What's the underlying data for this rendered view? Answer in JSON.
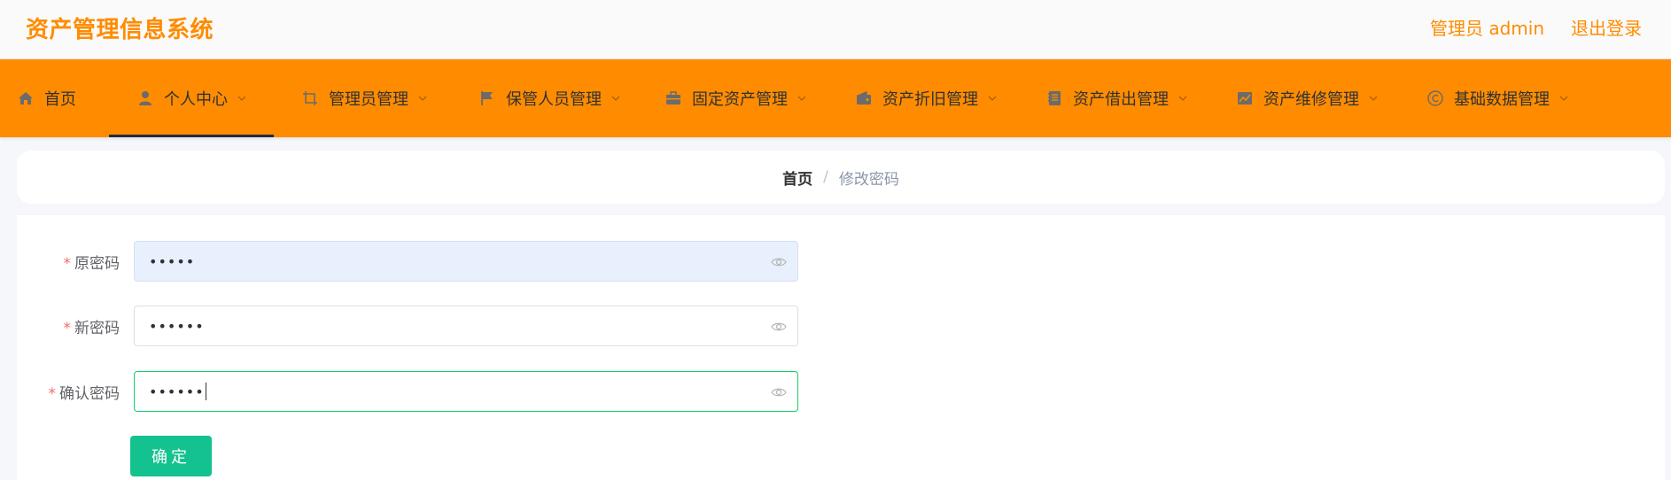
{
  "header": {
    "app_title": "资产管理信息系统",
    "user_label": "管理员 admin",
    "logout_label": "退出登录"
  },
  "nav": {
    "items": [
      {
        "label": "首页",
        "icon": "home-icon"
      },
      {
        "label": "个人中心",
        "icon": "user-icon"
      },
      {
        "label": "管理员管理",
        "icon": "crop-icon"
      },
      {
        "label": "保管人员管理",
        "icon": "flag-icon"
      },
      {
        "label": "固定资产管理",
        "icon": "briefcase-icon"
      },
      {
        "label": "资产折旧管理",
        "icon": "wallet-icon"
      },
      {
        "label": "资产借出管理",
        "icon": "notebook-icon"
      },
      {
        "label": "资产维修管理",
        "icon": "chart-icon"
      },
      {
        "label": "基础数据管理",
        "icon": "copyright-icon"
      }
    ],
    "active_index": 1
  },
  "breadcrumb": {
    "home": "首页",
    "separator": "/",
    "current": "修改密码"
  },
  "form": {
    "required_mark": "*",
    "old_password": {
      "label": "原密码",
      "value": "•••••"
    },
    "new_password": {
      "label": "新密码",
      "value": "••••••"
    },
    "confirm_password": {
      "label": "确认密码",
      "value": "••••••"
    },
    "submit_label": "确定"
  },
  "colors": {
    "accent": "#ff8c00",
    "submit": "#13c28f",
    "required": "#f56c6c"
  }
}
